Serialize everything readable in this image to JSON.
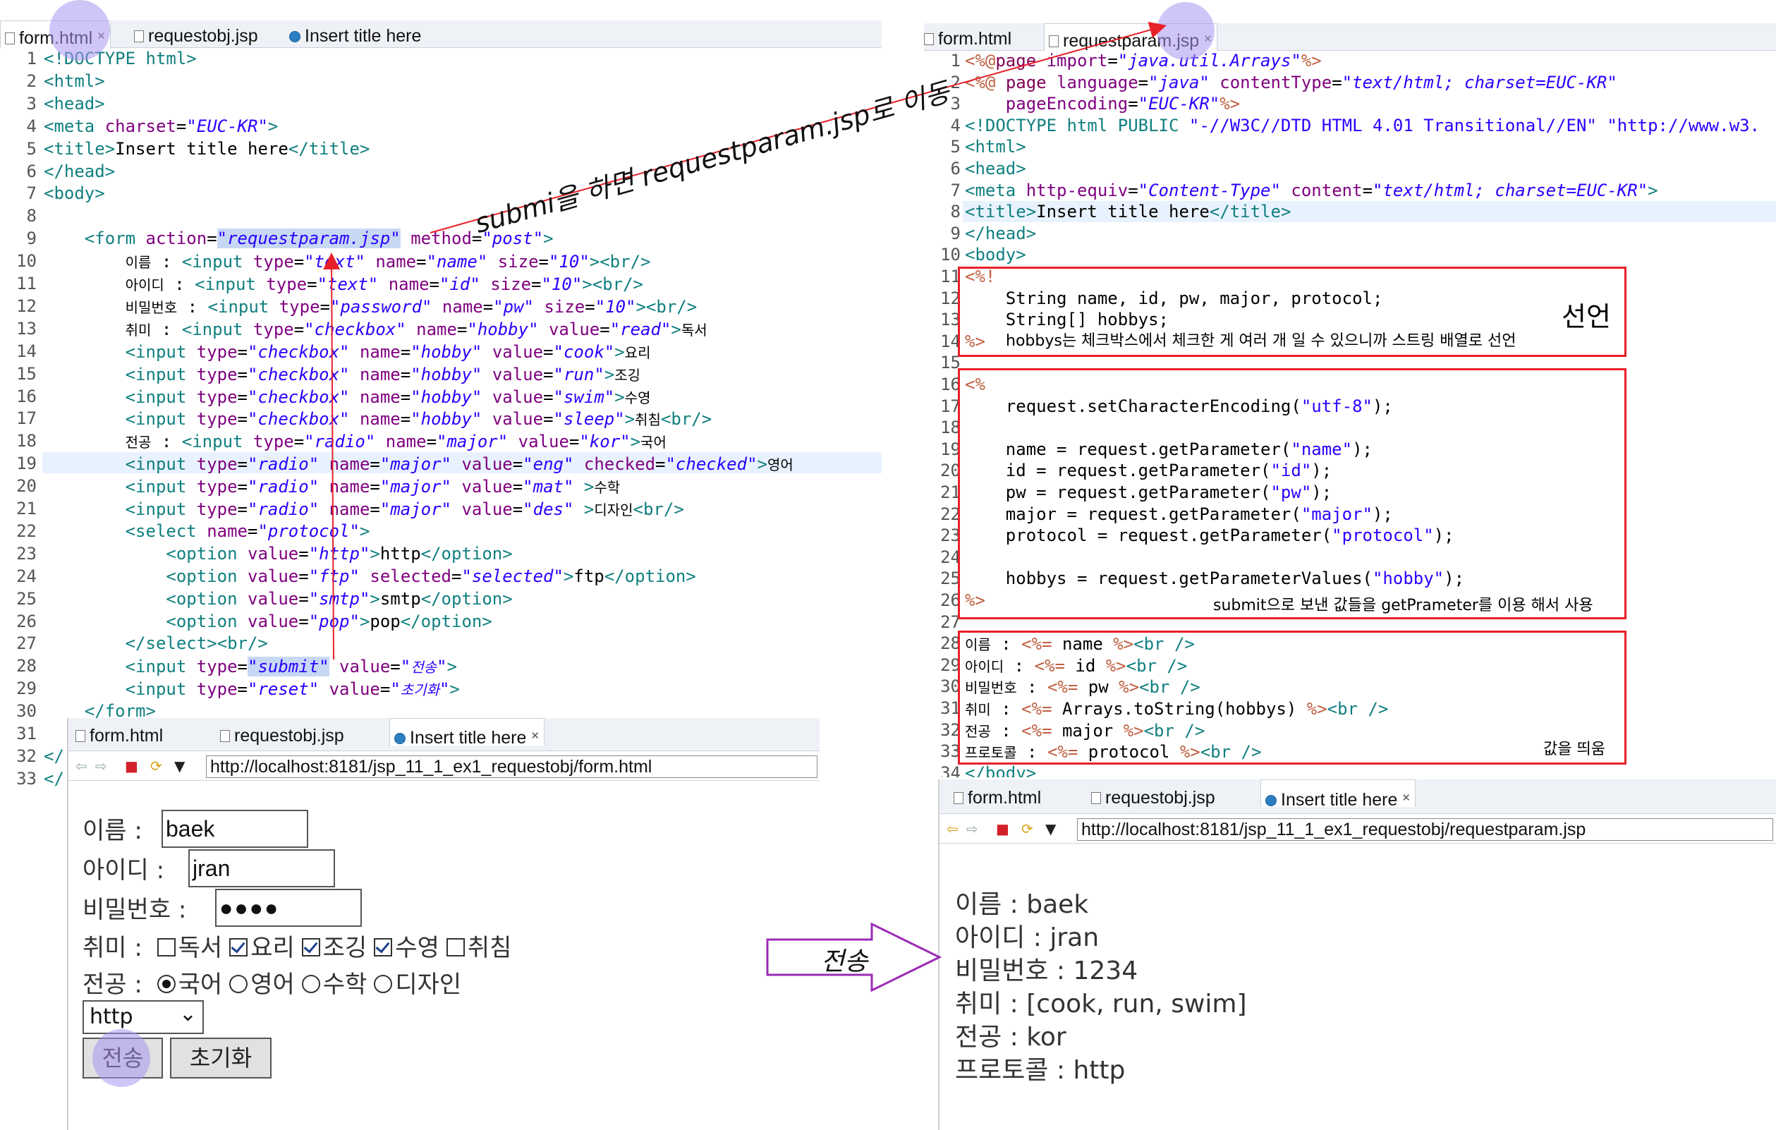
{
  "left_editor": {
    "tabs": [
      "form.html",
      "requestobj.jsp",
      "Insert title here"
    ],
    "lines": [
      {
        "n": "1",
        "html": "<span class=\"tg\">&lt;!DOCTYPE html&gt;</span>"
      },
      {
        "n": "2",
        "html": "<span class=\"tg\">&lt;html&gt;</span>"
      },
      {
        "n": "3",
        "html": "<span class=\"tg\">&lt;head&gt;</span>"
      },
      {
        "n": "4",
        "html": "<span class=\"tg\">&lt;meta</span> <span class=\"at\">charset</span>=<span class=\"st\">\"EUC-KR\"</span><span class=\"tg\">&gt;</span>"
      },
      {
        "n": "5",
        "html": "<span class=\"tg\">&lt;title&gt;</span>Insert title here<span class=\"tg\">&lt;/title&gt;</span>"
      },
      {
        "n": "6",
        "html": "<span class=\"tg\">&lt;/head&gt;</span>"
      },
      {
        "n": "7",
        "html": "<span class=\"tg\">&lt;body&gt;</span>"
      },
      {
        "n": "8",
        "html": ""
      },
      {
        "n": "9",
        "html": "    <span class=\"tg\">&lt;form</span> <span class=\"at\">action</span>=<span class=\"hl\">\"requestparam.jsp\"</span> <span class=\"at\">method</span>=<span class=\"st\">\"post\"</span><span class=\"tg\">&gt;</span>"
      },
      {
        "n": "10",
        "html": "        <span class=\"ko\">이름</span> : <span class=\"tg\">&lt;input</span> <span class=\"at\">type</span>=<span class=\"st\">\"text\"</span> <span class=\"at\">name</span>=<span class=\"st\">\"name\"</span> <span class=\"at\">size</span>=<span class=\"st\">\"10\"</span><span class=\"tg\">&gt;&lt;br/&gt;</span>"
      },
      {
        "n": "11",
        "html": "        <span class=\"ko\">아이디</span> : <span class=\"tg\">&lt;input</span> <span class=\"at\">type</span>=<span class=\"st\">\"text\"</span> <span class=\"at\">name</span>=<span class=\"st\">\"id\"</span> <span class=\"at\">size</span>=<span class=\"st\">\"10\"</span><span class=\"tg\">&gt;&lt;br/&gt;</span>"
      },
      {
        "n": "12",
        "html": "        <span class=\"ko\">비밀번호</span> : <span class=\"tg\">&lt;input</span> <span class=\"at\">type</span>=<span class=\"st\">\"password\"</span> <span class=\"at\">name</span>=<span class=\"st\">\"pw\"</span> <span class=\"at\">size</span>=<span class=\"st\">\"10\"</span><span class=\"tg\">&gt;&lt;br/&gt;</span>"
      },
      {
        "n": "13",
        "html": "        <span class=\"ko\">취미</span> : <span class=\"tg\">&lt;input</span> <span class=\"at\">type</span>=<span class=\"st\">\"checkbox\"</span> <span class=\"at\">name</span>=<span class=\"st\">\"hobby\"</span> <span class=\"at\">value</span>=<span class=\"st\">\"read\"</span><span class=\"tg\">&gt;</span><span class=\"ko\">독서</span>"
      },
      {
        "n": "14",
        "html": "        <span class=\"tg\">&lt;input</span> <span class=\"at\">type</span>=<span class=\"st\">\"checkbox\"</span> <span class=\"at\">name</span>=<span class=\"st\">\"hobby\"</span> <span class=\"at\">value</span>=<span class=\"st\">\"cook\"</span><span class=\"tg\">&gt;</span><span class=\"ko\">요리</span>"
      },
      {
        "n": "15",
        "html": "        <span class=\"tg\">&lt;input</span> <span class=\"at\">type</span>=<span class=\"st\">\"checkbox\"</span> <span class=\"at\">name</span>=<span class=\"st\">\"hobby\"</span> <span class=\"at\">value</span>=<span class=\"st\">\"run\"</span><span class=\"tg\">&gt;</span><span class=\"ko\">조깅</span>"
      },
      {
        "n": "16",
        "html": "        <span class=\"tg\">&lt;input</span> <span class=\"at\">type</span>=<span class=\"st\">\"checkbox\"</span> <span class=\"at\">name</span>=<span class=\"st\">\"hobby\"</span> <span class=\"at\">value</span>=<span class=\"st\">\"swim\"</span><span class=\"tg\">&gt;</span><span class=\"ko\">수영</span>"
      },
      {
        "n": "17",
        "html": "        <span class=\"tg\">&lt;input</span> <span class=\"at\">type</span>=<span class=\"st\">\"checkbox\"</span> <span class=\"at\">name</span>=<span class=\"st\">\"hobby\"</span> <span class=\"at\">value</span>=<span class=\"st\">\"sleep\"</span><span class=\"tg\">&gt;</span><span class=\"ko\">취침</span><span class=\"tg\">&lt;br/&gt;</span>"
      },
      {
        "n": "18",
        "html": "        <span class=\"ko\">전공</span> : <span class=\"tg\">&lt;input</span> <span class=\"at\">type</span>=<span class=\"st\">\"radio\"</span> <span class=\"at\">name</span>=<span class=\"st\">\"major\"</span> <span class=\"at\">value</span>=<span class=\"st\">\"kor\"</span><span class=\"tg\">&gt;</span><span class=\"ko\">국어</span>"
      },
      {
        "n": "19",
        "html": "        <span class=\"tg\">&lt;input</span> <span class=\"at\">type</span>=<span class=\"st\">\"radio\"</span> <span class=\"at\">name</span>=<span class=\"st\">\"major\"</span> <span class=\"at\">value</span>=<span class=\"st\">\"eng\"</span> <span class=\"at\">checked</span>=<span class=\"st\">\"checked\"</span><span class=\"tg\">&gt;</span><span class=\"ko\">영어</span>"
      },
      {
        "n": "20",
        "html": "        <span class=\"tg\">&lt;input</span> <span class=\"at\">type</span>=<span class=\"st\">\"radio\"</span> <span class=\"at\">name</span>=<span class=\"st\">\"major\"</span> <span class=\"at\">value</span>=<span class=\"st\">\"mat\"</span> <span class=\"tg\">&gt;</span><span class=\"ko\">수학</span>"
      },
      {
        "n": "21",
        "html": "        <span class=\"tg\">&lt;input</span> <span class=\"at\">type</span>=<span class=\"st\">\"radio\"</span> <span class=\"at\">name</span>=<span class=\"st\">\"major\"</span> <span class=\"at\">value</span>=<span class=\"st\">\"des\"</span> <span class=\"tg\">&gt;</span><span class=\"ko\">디자인</span><span class=\"tg\">&lt;br/&gt;</span>"
      },
      {
        "n": "22",
        "html": "        <span class=\"tg\">&lt;select</span> <span class=\"at\">name</span>=<span class=\"st\">\"protocol\"</span><span class=\"tg\">&gt;</span>"
      },
      {
        "n": "23",
        "html": "            <span class=\"tg\">&lt;option</span> <span class=\"at\">value</span>=<span class=\"st\">\"http\"</span><span class=\"tg\">&gt;</span>http<span class=\"tg\">&lt;/option&gt;</span>"
      },
      {
        "n": "24",
        "html": "            <span class=\"tg\">&lt;option</span> <span class=\"at\">value</span>=<span class=\"st\">\"ftp\"</span> <span class=\"at\">selected</span>=<span class=\"st\">\"selected\"</span><span class=\"tg\">&gt;</span>ftp<span class=\"tg\">&lt;/option&gt;</span>"
      },
      {
        "n": "25",
        "html": "            <span class=\"tg\">&lt;option</span> <span class=\"at\">value</span>=<span class=\"st\">\"smtp\"</span><span class=\"tg\">&gt;</span>smtp<span class=\"tg\">&lt;/option&gt;</span>"
      },
      {
        "n": "26",
        "html": "            <span class=\"tg\">&lt;option</span> <span class=\"at\">value</span>=<span class=\"st\">\"pop\"</span><span class=\"tg\">&gt;</span>pop<span class=\"tg\">&lt;/option&gt;</span>"
      },
      {
        "n": "27",
        "html": "        <span class=\"tg\">&lt;/select&gt;&lt;br/&gt;</span>"
      },
      {
        "n": "28",
        "html": "        <span class=\"tg\">&lt;input</span> <span class=\"at\">type</span>=<span class=\"hl\">\"submit\"</span> <span class=\"at\">value</span>=<span class=\"st\">\"<span class=\"ko\">전송</span>\"</span><span class=\"tg\">&gt;</span>"
      },
      {
        "n": "29",
        "html": "        <span class=\"tg\">&lt;input</span> <span class=\"at\">type</span>=<span class=\"st\">\"reset\"</span> <span class=\"at\">value</span>=<span class=\"st\">\"<span class=\"ko\">초기화</span>\"</span><span class=\"tg\">&gt;</span>"
      },
      {
        "n": "30",
        "html": "    <span class=\"tg\">&lt;/form&gt;</span>"
      },
      {
        "n": "31",
        "html": ""
      },
      {
        "n": "32",
        "html": "<span class=\"tg\">&lt;/</span>"
      },
      {
        "n": "33",
        "html": "<span class=\"tg\">&lt;/</span>"
      }
    ]
  },
  "right_editor": {
    "tabs": [
      "form.html",
      "requestparam.jsp"
    ],
    "lines": [
      {
        "n": "1",
        "html": "<span class=\"sc\">&lt;%@</span><span class=\"kw\">page</span> <span class=\"at\">import</span>=<span class=\"st\">\"java.util.Arrays\"</span><span class=\"sc\">%&gt;</span>"
      },
      {
        "n": "2",
        "html": "<span class=\"sc\">&lt;%@</span> <span class=\"kw\">page</span> <span class=\"at\">language</span>=<span class=\"st\">\"java\"</span> <span class=\"at\">contentType</span>=<span class=\"st\">\"text/html; charset=EUC-KR\"</span>"
      },
      {
        "n": "3",
        "html": "    <span class=\"at\">pageEncoding</span>=<span class=\"st\">\"EUC-KR\"</span><span class=\"sc\">%&gt;</span>"
      },
      {
        "n": "4",
        "html": "<span class=\"tg\">&lt;!DOCTYPE html PUBLIC</span> <span class=\"jt\">\"-//W3C//DTD HTML 4.01 Transitional//EN\"</span> <span class=\"jt\">\"http://www.w3.</span>"
      },
      {
        "n": "5",
        "html": "<span class=\"tg\">&lt;html&gt;</span>"
      },
      {
        "n": "6",
        "html": "<span class=\"tg\">&lt;head&gt;</span>"
      },
      {
        "n": "7",
        "html": "<span class=\"tg\">&lt;meta</span> <span class=\"at\">http-equiv</span>=<span class=\"st\">\"Content-Type\"</span> <span class=\"at\">content</span>=<span class=\"st\">\"text/html; charset=EUC-KR\"</span><span class=\"tg\">&gt;</span>"
      },
      {
        "n": "8",
        "html": "<span class=\"tg\">&lt;title&gt;</span>Insert title here<span class=\"tg\">&lt;/title&gt;</span>"
      },
      {
        "n": "9",
        "html": "<span class=\"tg\">&lt;/head&gt;</span>"
      },
      {
        "n": "10",
        "html": "<span class=\"tg\">&lt;body&gt;</span>"
      },
      {
        "n": "11",
        "html": "<span class=\"sc\">&lt;%!</span>"
      },
      {
        "n": "12",
        "html": "    String name, id, pw, major, protocol;"
      },
      {
        "n": "13",
        "html": "    String[] hobbys;"
      },
      {
        "n": "14",
        "html": "<span class=\"sc\">%&gt;</span>"
      },
      {
        "n": "15",
        "html": ""
      },
      {
        "n": "16",
        "html": "<span class=\"sc\">&lt;%</span>"
      },
      {
        "n": "17",
        "html": "    request.setCharacterEncoding(<span class=\"jt\">\"utf-8\"</span>);"
      },
      {
        "n": "18",
        "html": ""
      },
      {
        "n": "19",
        "html": "    name = request.getParameter(<span class=\"jt\">\"name\"</span>);"
      },
      {
        "n": "20",
        "html": "    id = request.getParameter(<span class=\"jt\">\"id\"</span>);"
      },
      {
        "n": "21",
        "html": "    pw = request.getParameter(<span class=\"jt\">\"pw\"</span>);"
      },
      {
        "n": "22",
        "html": "    major = request.getParameter(<span class=\"jt\">\"major\"</span>);"
      },
      {
        "n": "23",
        "html": "    protocol = request.getParameter(<span class=\"jt\">\"protocol\"</span>);"
      },
      {
        "n": "24",
        "html": ""
      },
      {
        "n": "25",
        "html": "    hobbys = request.getParameterValues(<span class=\"jt\">\"hobby\"</span>);"
      },
      {
        "n": "26",
        "html": "<span class=\"sc\">%&gt;</span>"
      },
      {
        "n": "27",
        "html": ""
      },
      {
        "n": "28",
        "html": "<span class=\"ko\">이름</span> : <span class=\"sc\">&lt;%=</span> name <span class=\"sc\">%&gt;</span><span class=\"tg\">&lt;br /&gt;</span>"
      },
      {
        "n": "29",
        "html": "<span class=\"ko\">아이디</span> : <span class=\"sc\">&lt;%=</span> id <span class=\"sc\">%&gt;</span><span class=\"tg\">&lt;br /&gt;</span>"
      },
      {
        "n": "30",
        "html": "<span class=\"ko\">비밀번호</span> : <span class=\"sc\">&lt;%=</span> pw <span class=\"sc\">%&gt;</span><span class=\"tg\">&lt;br /&gt;</span>"
      },
      {
        "n": "31",
        "html": "<span class=\"ko\">취미</span> : <span class=\"sc\">&lt;%=</span> Arrays.toString(hobbys) <span class=\"sc\">%&gt;</span><span class=\"tg\">&lt;br /&gt;</span>"
      },
      {
        "n": "32",
        "html": "<span class=\"ko\">전공</span> : <span class=\"sc\">&lt;%=</span> major <span class=\"sc\">%&gt;</span><span class=\"tg\">&lt;br /&gt;</span>"
      },
      {
        "n": "33",
        "html": "<span class=\"ko\">프로토콜</span> : <span class=\"sc\">&lt;%=</span> protocol <span class=\"sc\">%&gt;</span><span class=\"tg\">&lt;br /&gt;</span>"
      },
      {
        "n": "34",
        "html": "<span class=\"tg\">&lt;/body&gt;</span>"
      }
    ],
    "annotations": {
      "declare": "선언",
      "declare_note": "hobbys는 체크박스에서 체크한 게 여러 개 일 수 있으니까 스트링 배열로 선언",
      "getparam_note": "submit으로 보낸 값들을 getPrameter를 이용 해서 사용",
      "print_note": "값을 띄움"
    }
  },
  "arrow_label": "submi을 하면 requestparam.jsp로 이동",
  "send_label": "전송",
  "left_browser": {
    "tabs": [
      "form.html",
      "requestobj.jsp",
      "Insert title here"
    ],
    "url": "http://localhost:8181/jsp_11_1_ex1_requestobj/form.html",
    "name_label": "이름 :",
    "name_value": "baek",
    "id_label": "아이디 :",
    "id_value": "jran",
    "pw_label": "비밀번호 :",
    "pw_value": "●●●●",
    "hobby_label": "취미 :",
    "hobbies": [
      {
        "label": "독서",
        "checked": false
      },
      {
        "label": "요리",
        "checked": true
      },
      {
        "label": "조깅",
        "checked": true
      },
      {
        "label": "수영",
        "checked": true
      },
      {
        "label": "취침",
        "checked": false
      }
    ],
    "major_label": "전공 :",
    "majors": [
      {
        "label": "국어",
        "checked": true
      },
      {
        "label": "영어",
        "checked": false
      },
      {
        "label": "수학",
        "checked": false
      },
      {
        "label": "디자인",
        "checked": false
      }
    ],
    "protocol_value": "http",
    "submit_label": "전송",
    "reset_label": "초기화"
  },
  "right_browser": {
    "tabs": [
      "form.html",
      "requestobj.jsp",
      "Insert title here"
    ],
    "url": "http://localhost:8181/jsp_11_1_ex1_requestobj/requestparam.jsp",
    "results": [
      "이름 : baek",
      "아이디 : jran",
      "비밀번호 : 1234",
      "취미 : [cook, run, swim]",
      "전공 : kor",
      "프로토콜 : http"
    ]
  }
}
